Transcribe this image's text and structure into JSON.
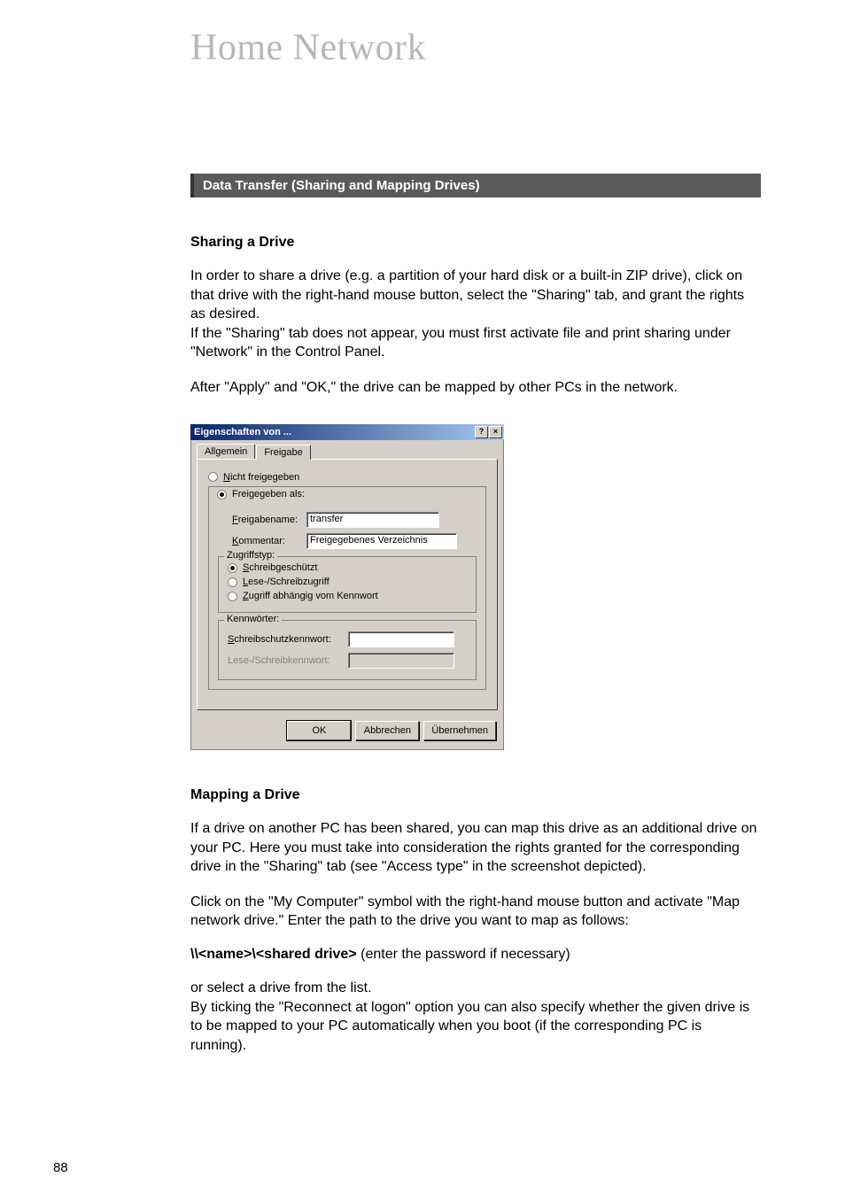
{
  "page_title": "Home Network",
  "section_bar": "Data Transfer (Sharing and Mapping Drives)",
  "sharing": {
    "heading": "Sharing a Drive",
    "p1": "In order to share a drive (e.g. a partition of your hard disk or a built-in ZIP drive), click on that drive with the right-hand mouse button, select the \"Sharing\" tab, and grant the rights as desired.",
    "p2": "If the \"Sharing\" tab does not appear, you must first activate file and print sharing under \"Network\" in the Control Panel.",
    "p3": "After \"Apply\" and \"OK,\" the drive can be mapped by other PCs in the network."
  },
  "dialog": {
    "title": "Eigenschaften von ...",
    "help_btn": "?",
    "close_btn": "×",
    "tabs": {
      "general": "Allgemein",
      "sharing": "Freigabe"
    },
    "radio_not_shared": "Nicht freigegeben",
    "radio_shared_as": "Freigegeben als:",
    "share_name_label": "Freigabename:",
    "share_name_value": "transfer",
    "comment_label": "Kommentar:",
    "comment_value": "Freigegebenes Verzeichnis",
    "access_legend": "Zugriffstyp:",
    "access_readonly": "Schreibgeschützt",
    "access_readwrite": "Lese-/Schreibzugriff",
    "access_pwd": "Zugriff abhängig vom Kennwort",
    "passwords_legend": "Kennwörter:",
    "readonly_pwd_label": "Schreibschutzkennwort:",
    "readwrite_pwd_label": "Lese-/Schreibkennwort:",
    "buttons": {
      "ok": "OK",
      "cancel": "Abbrechen",
      "apply": "Übernehmen"
    }
  },
  "mapping": {
    "heading": "Mapping a Drive",
    "p1": "If a drive on another PC has been shared, you can map this drive as an additional drive on your PC. Here you must take into consideration the rights granted for the corresponding drive in the \"Sharing\" tab (see \"Access type\" in the screenshot depicted).",
    "p2": "Click on the \"My Computer\" symbol with the right-hand mouse button and activate \"Map network drive.\" Enter the path to the drive you want to map as follows:",
    "path_bold": "\\\\<name>\\<shared drive>",
    "path_rest": "  (enter the password if necessary)",
    "p3": "or select a drive from the list.",
    "p4": "By ticking the \"Reconnect at logon\" option you can also specify whether the given drive is to be mapped to your PC automatically when you boot (if the corresponding PC is running)."
  },
  "page_number": "88"
}
